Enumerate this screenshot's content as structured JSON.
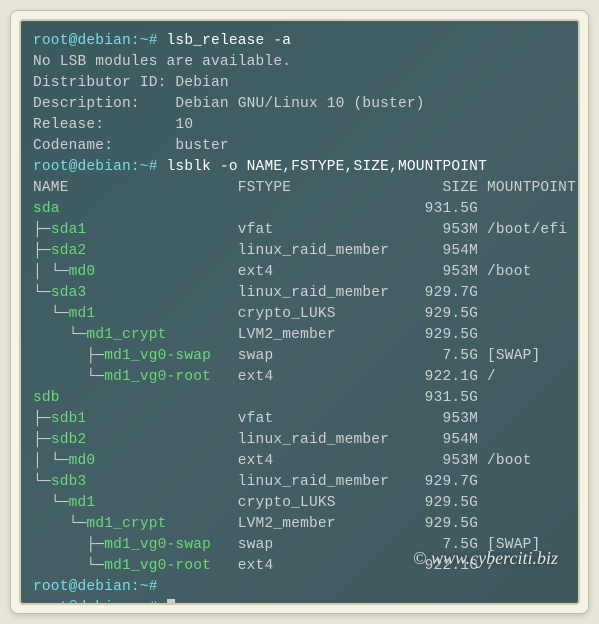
{
  "prompt": "root@debian:~#",
  "commands": {
    "cmd1": "lsb_release -a",
    "cmd2": "lsblk -o NAME,FSTYPE,SIZE,MOUNTPOINT"
  },
  "lsb_output": {
    "no_modules": "No LSB modules are available.",
    "distributor_label": "Distributor ID:",
    "distributor_value": "Debian",
    "description_label": "Description:",
    "description_value": "Debian GNU/Linux 10 (buster)",
    "release_label": "Release:",
    "release_value": "10",
    "codename_label": "Codename:",
    "codename_value": "buster"
  },
  "lsblk_header": {
    "name": "NAME",
    "fstype": "FSTYPE",
    "size": "SIZE",
    "mountpoint": "MOUNTPOINT"
  },
  "lsblk_rows": [
    {
      "tree": "",
      "name": "sda",
      "fstype": "",
      "size": "931.5G",
      "mountpoint": ""
    },
    {
      "tree": "├─",
      "name": "sda1",
      "fstype": "vfat",
      "size": "953M",
      "mountpoint": "/boot/efi"
    },
    {
      "tree": "├─",
      "name": "sda2",
      "fstype": "linux_raid_member",
      "size": "954M",
      "mountpoint": ""
    },
    {
      "tree": "│ └─",
      "name": "md0",
      "fstype": "ext4",
      "size": "953M",
      "mountpoint": "/boot"
    },
    {
      "tree": "└─",
      "name": "sda3",
      "fstype": "linux_raid_member",
      "size": "929.7G",
      "mountpoint": ""
    },
    {
      "tree": "  └─",
      "name": "md1",
      "fstype": "crypto_LUKS",
      "size": "929.5G",
      "mountpoint": ""
    },
    {
      "tree": "    └─",
      "name": "md1_crypt",
      "fstype": "LVM2_member",
      "size": "929.5G",
      "mountpoint": ""
    },
    {
      "tree": "      ├─",
      "name": "md1_vg0-swap",
      "fstype": "swap",
      "size": "7.5G",
      "mountpoint": "[SWAP]"
    },
    {
      "tree": "      └─",
      "name": "md1_vg0-root",
      "fstype": "ext4",
      "size": "922.1G",
      "mountpoint": "/"
    },
    {
      "tree": "",
      "name": "sdb",
      "fstype": "",
      "size": "931.5G",
      "mountpoint": ""
    },
    {
      "tree": "├─",
      "name": "sdb1",
      "fstype": "vfat",
      "size": "953M",
      "mountpoint": ""
    },
    {
      "tree": "├─",
      "name": "sdb2",
      "fstype": "linux_raid_member",
      "size": "954M",
      "mountpoint": ""
    },
    {
      "tree": "│ └─",
      "name": "md0",
      "fstype": "ext4",
      "size": "953M",
      "mountpoint": "/boot"
    },
    {
      "tree": "└─",
      "name": "sdb3",
      "fstype": "linux_raid_member",
      "size": "929.7G",
      "mountpoint": ""
    },
    {
      "tree": "  └─",
      "name": "md1",
      "fstype": "crypto_LUKS",
      "size": "929.5G",
      "mountpoint": ""
    },
    {
      "tree": "    └─",
      "name": "md1_crypt",
      "fstype": "LVM2_member",
      "size": "929.5G",
      "mountpoint": ""
    },
    {
      "tree": "      ├─",
      "name": "md1_vg0-swap",
      "fstype": "swap",
      "size": "7.5G",
      "mountpoint": "[SWAP]"
    },
    {
      "tree": "      └─",
      "name": "md1_vg0-root",
      "fstype": "ext4",
      "size": "922.1G",
      "mountpoint": "/"
    }
  ],
  "watermark": "© www.cyberciti.biz"
}
